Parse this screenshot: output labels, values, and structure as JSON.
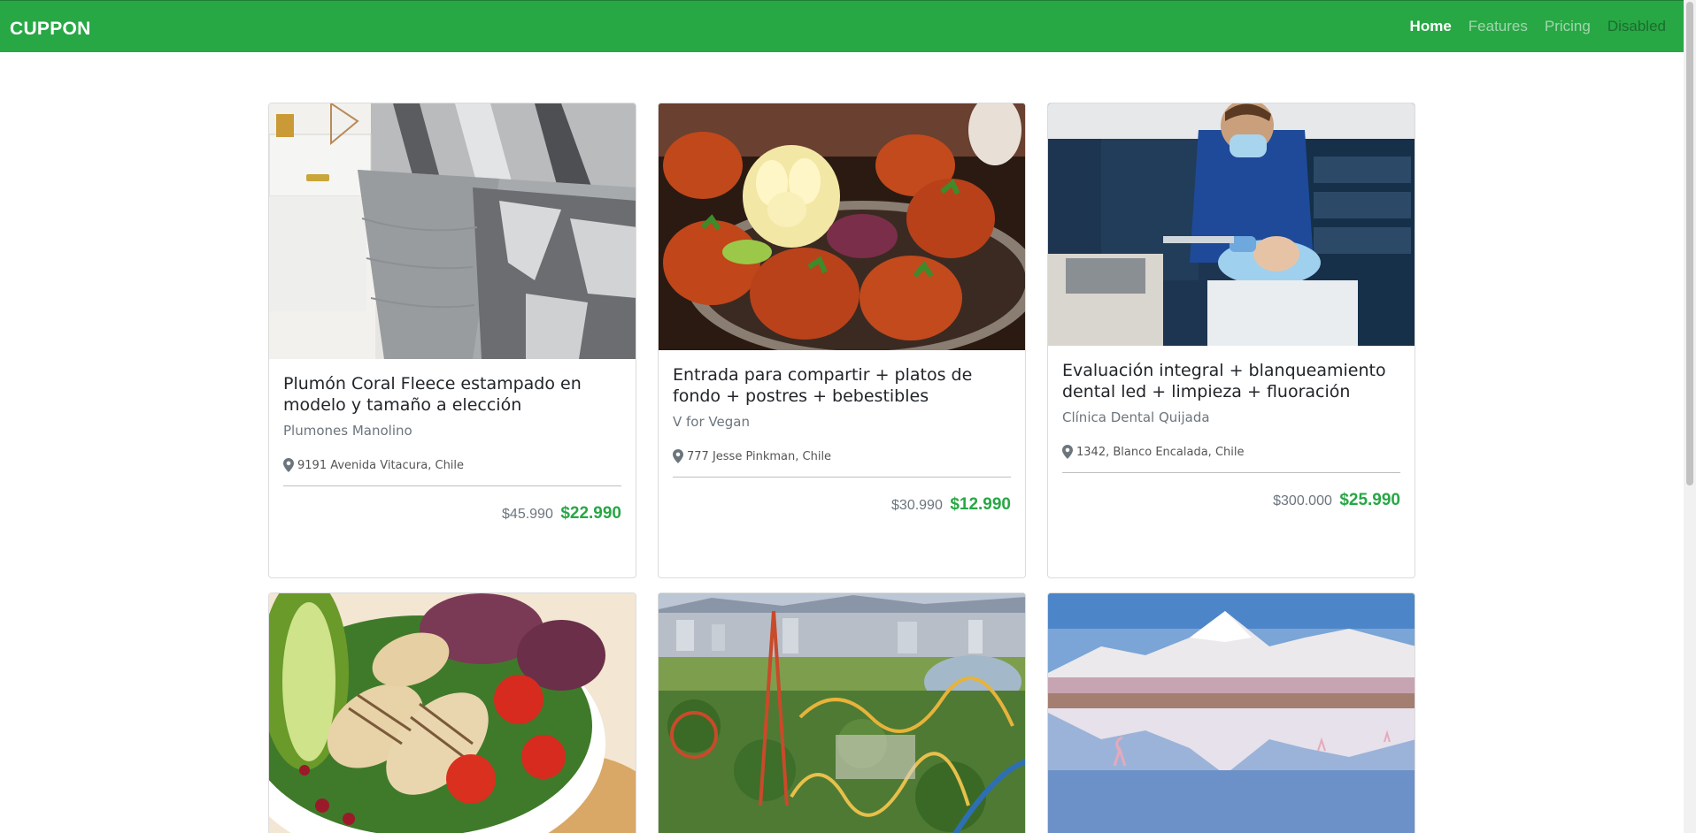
{
  "navbar": {
    "brand": "CUPPON",
    "links": [
      "Home",
      "Features",
      "Pricing",
      "Disabled"
    ]
  },
  "cards": [
    {
      "title": "Plumón Coral Fleece estampado en modelo y tamaño a elección",
      "vendor": "Plumones Manolino",
      "location": "9191 Avenida Vitacura, Chile",
      "old_price": "$45.990",
      "new_price": "$22.990",
      "image": "bedroom-comforter-photo"
    },
    {
      "title": "Entrada para compartir + platos de fondo + postres + bebestibles",
      "vendor": "V for Vegan",
      "location": "777 Jesse Pinkman, Chile",
      "old_price": "$30.990",
      "new_price": "$12.990",
      "image": "tandoori-food-photo"
    },
    {
      "title": "Evaluación integral + blanqueamiento dental led + limpieza + fluoración",
      "vendor": "Clínica Dental Quijada",
      "location": "1342, Blanco Encalada, Chile",
      "old_price": "$300.000",
      "new_price": "$25.990",
      "image": "dentist-photo"
    },
    {
      "image": "chicken-salad-photo"
    },
    {
      "image": "amusement-park-photo"
    },
    {
      "image": "desert-lagoon-photo"
    }
  ],
  "colors": {
    "brand_green": "#28a745",
    "muted": "#6c757d"
  }
}
